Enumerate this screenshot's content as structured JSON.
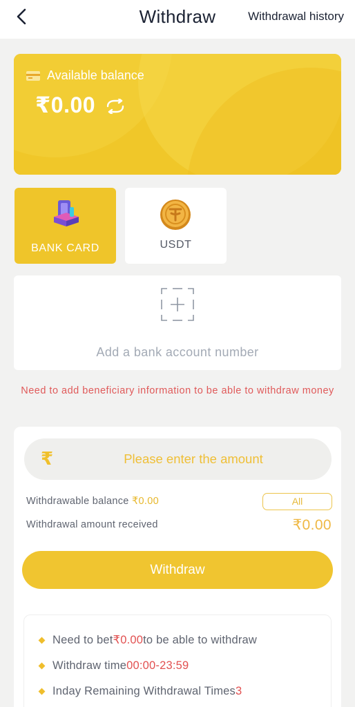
{
  "header": {
    "title": "Withdraw",
    "history_label": "Withdrawal history"
  },
  "balance": {
    "label": "Available balance",
    "amount": "₹0.00"
  },
  "methods": [
    {
      "label": "BANK CARD",
      "icon": "bank-card-icon",
      "selected": true
    },
    {
      "label": "USDT",
      "icon": "usdt-coin-icon",
      "selected": false
    }
  ],
  "add_bank": {
    "label": "Add a bank account number"
  },
  "warning": "Need to add beneficiary information to be able to withdraw money",
  "amount_input": {
    "currency_symbol": "₹",
    "placeholder": "Please enter the amount"
  },
  "withdrawable": {
    "label": "Withdrawable balance ",
    "value": "₹0.00",
    "all_label": "All"
  },
  "received": {
    "label": "Withdrawal amount received",
    "value": "₹0.00"
  },
  "withdraw_button": "Withdraw",
  "notes": [
    {
      "text_before": "Need to bet ",
      "highlight": "₹0.00",
      "text_after": " to be able to withdraw"
    },
    {
      "text_before": "Withdraw time ",
      "highlight": "00:00-23:59",
      "text_after": ""
    },
    {
      "text_before": "Inday Remaining Withdrawal Times",
      "highlight": "3",
      "text_after": ""
    }
  ],
  "colors": {
    "brand": "#f0c52c",
    "warning": "#e05a5a",
    "background": "#f2f2f1"
  }
}
